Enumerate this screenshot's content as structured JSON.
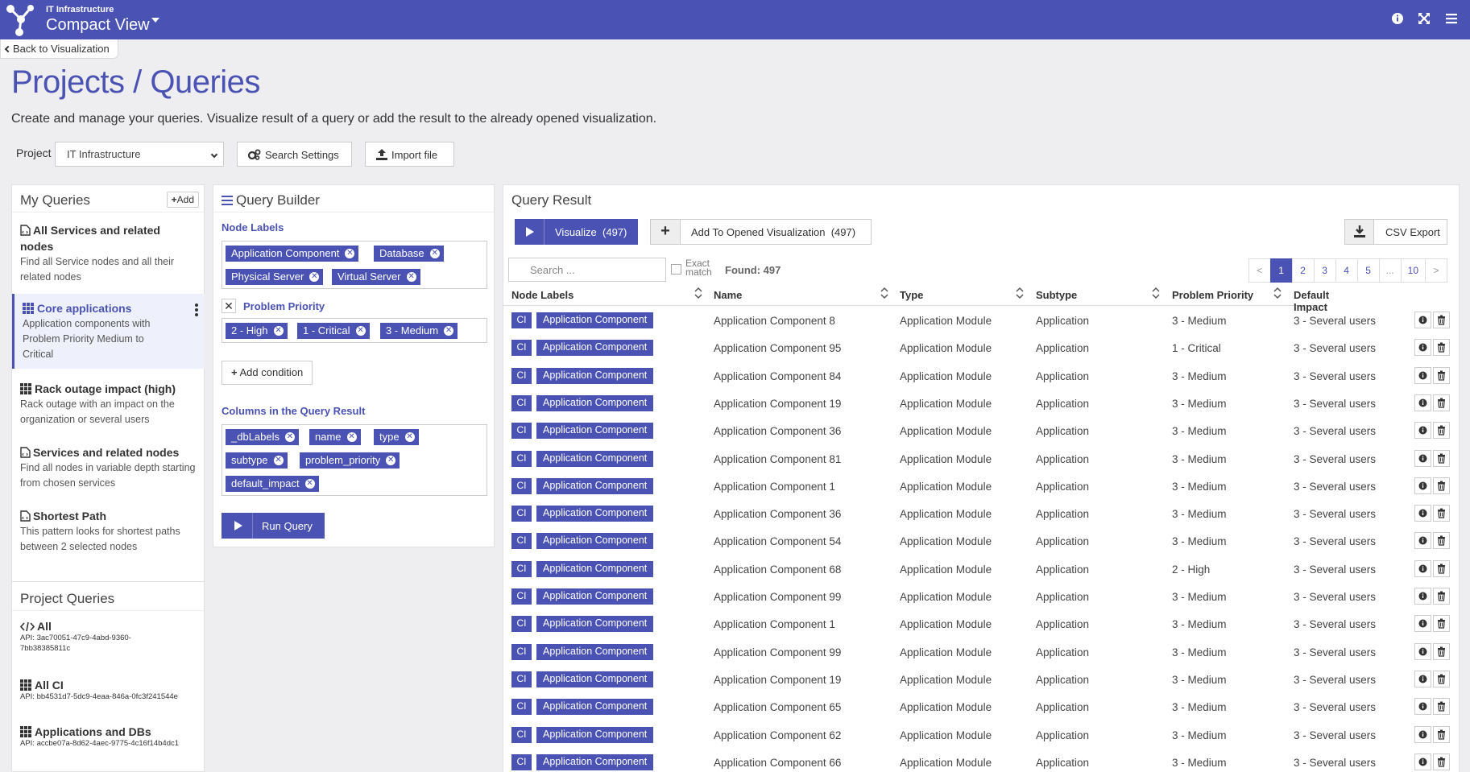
{
  "header": {
    "subtitle": "IT Infrastructure",
    "title": "Compact View",
    "accent": "#4a52b3"
  },
  "back_link": "Back to Visualization",
  "page": {
    "title": "Projects / Queries",
    "description": "Create and manage your queries. Visualize result of a query or add the result to the already opened visualization."
  },
  "toolbar": {
    "project_label": "Project",
    "project_value": "IT Infrastructure",
    "search_settings": "Search Settings",
    "import_file": "Import file"
  },
  "my_queries": {
    "title": "My Queries",
    "add_label": "Add",
    "items": [
      {
        "title": "All Services and related nodes",
        "desc": "Find all Service nodes and all their related nodes",
        "icon": "file-code-icon"
      },
      {
        "title": "Core applications",
        "desc": "Application components with Problem Priority Medium to Critical",
        "icon": "grid-icon"
      },
      {
        "title": "Rack outage impact (high)",
        "desc": "Rack outage with an impact on the organization or several users",
        "icon": "grid-icon"
      },
      {
        "title": "Services and related nodes",
        "desc": "Find all nodes in variable depth starting from chosen services",
        "icon": "file-code-icon"
      },
      {
        "title": "Shortest Path",
        "desc": "This pattern looks for shortest paths between 2 selected nodes",
        "icon": "file-code-icon"
      }
    ]
  },
  "project_queries": {
    "title": "Project Queries",
    "items": [
      {
        "title": "All",
        "api": "API: 3ac70051-47c9-4abd-9360-7bb38385811c",
        "icon": "code-icon"
      },
      {
        "title": "All CI",
        "api": "API: bb4531d7-5dc9-4eaa-846a-0fc3f241544e",
        "icon": "grid-icon"
      },
      {
        "title": "Applications and DBs",
        "api": "API: accbe07a-8d62-4aec-9775-4c16f14b4dc1",
        "icon": "grid-icon"
      }
    ]
  },
  "query_builder": {
    "title": "Query Builder",
    "node_labels_title": "Node Labels",
    "node_labels": [
      "Application Component",
      "Database",
      "Physical Server",
      "Virtual Server"
    ],
    "condition_title": "Problem Priority",
    "condition_values": [
      "2 - High",
      "1 - Critical",
      "3 - Medium"
    ],
    "add_condition": "Add condition",
    "columns_title": "Columns in the Query Result",
    "columns": [
      "_dbLabels",
      "name",
      "type",
      "subtype",
      "problem_priority",
      "default_impact"
    ],
    "run_query": "Run Query"
  },
  "query_result": {
    "title": "Query Result",
    "visualize": "Visualize  (497)",
    "add_to_opened": "Add To Opened Visualization  (497)",
    "csv_export": "CSV Export",
    "search_placeholder": "Search ...",
    "exact_match": "Exact match",
    "found": "Found: 497",
    "pager": [
      "<",
      "1",
      "2",
      "3",
      "4",
      "5",
      "...",
      "10",
      ">"
    ],
    "pager_active": "1",
    "columns": [
      "Node Labels",
      "Name",
      "Type",
      "Subtype",
      "Problem Priority",
      "Default Impact"
    ],
    "rows": [
      {
        "ci": "CI",
        "label": "Application Component",
        "name": "Application Component 8",
        "type": "Application Module",
        "subtype": "Application",
        "priority": "3 - Medium",
        "impact": "3 - Several users"
      },
      {
        "ci": "CI",
        "label": "Application Component",
        "name": "Application Component 95",
        "type": "Application Module",
        "subtype": "Application",
        "priority": "1 - Critical",
        "impact": "3 - Several users"
      },
      {
        "ci": "CI",
        "label": "Application Component",
        "name": "Application Component 84",
        "type": "Application Module",
        "subtype": "Application",
        "priority": "3 - Medium",
        "impact": "3 - Several users"
      },
      {
        "ci": "CI",
        "label": "Application Component",
        "name": "Application Component 19",
        "type": "Application Module",
        "subtype": "Application",
        "priority": "3 - Medium",
        "impact": "3 - Several users"
      },
      {
        "ci": "CI",
        "label": "Application Component",
        "name": "Application Component 36",
        "type": "Application Module",
        "subtype": "Application",
        "priority": "3 - Medium",
        "impact": "3 - Several users"
      },
      {
        "ci": "CI",
        "label": "Application Component",
        "name": "Application Component 81",
        "type": "Application Module",
        "subtype": "Application",
        "priority": "3 - Medium",
        "impact": "3 - Several users"
      },
      {
        "ci": "CI",
        "label": "Application Component",
        "name": "Application Component 1",
        "type": "Application Module",
        "subtype": "Application",
        "priority": "3 - Medium",
        "impact": "3 - Several users"
      },
      {
        "ci": "CI",
        "label": "Application Component",
        "name": "Application Component 36",
        "type": "Application Module",
        "subtype": "Application",
        "priority": "3 - Medium",
        "impact": "3 - Several users"
      },
      {
        "ci": "CI",
        "label": "Application Component",
        "name": "Application Component 54",
        "type": "Application Module",
        "subtype": "Application",
        "priority": "3 - Medium",
        "impact": "3 - Several users"
      },
      {
        "ci": "CI",
        "label": "Application Component",
        "name": "Application Component 68",
        "type": "Application Module",
        "subtype": "Application",
        "priority": "2 - High",
        "impact": "3 - Several users"
      },
      {
        "ci": "CI",
        "label": "Application Component",
        "name": "Application Component 99",
        "type": "Application Module",
        "subtype": "Application",
        "priority": "3 - Medium",
        "impact": "3 - Several users"
      },
      {
        "ci": "CI",
        "label": "Application Component",
        "name": "Application Component 1",
        "type": "Application Module",
        "subtype": "Application",
        "priority": "3 - Medium",
        "impact": "3 - Several users"
      },
      {
        "ci": "CI",
        "label": "Application Component",
        "name": "Application Component 99",
        "type": "Application Module",
        "subtype": "Application",
        "priority": "3 - Medium",
        "impact": "3 - Several users"
      },
      {
        "ci": "CI",
        "label": "Application Component",
        "name": "Application Component 19",
        "type": "Application Module",
        "subtype": "Application",
        "priority": "3 - Medium",
        "impact": "3 - Several users"
      },
      {
        "ci": "CI",
        "label": "Application Component",
        "name": "Application Component 65",
        "type": "Application Module",
        "subtype": "Application",
        "priority": "3 - Medium",
        "impact": "3 - Several users"
      },
      {
        "ci": "CI",
        "label": "Application Component",
        "name": "Application Component 62",
        "type": "Application Module",
        "subtype": "Application",
        "priority": "3 - Medium",
        "impact": "3 - Several users"
      },
      {
        "ci": "CI",
        "label": "Application Component",
        "name": "Application Component 66",
        "type": "Application Module",
        "subtype": "Application",
        "priority": "3 - Medium",
        "impact": "3 - Several users"
      }
    ]
  }
}
